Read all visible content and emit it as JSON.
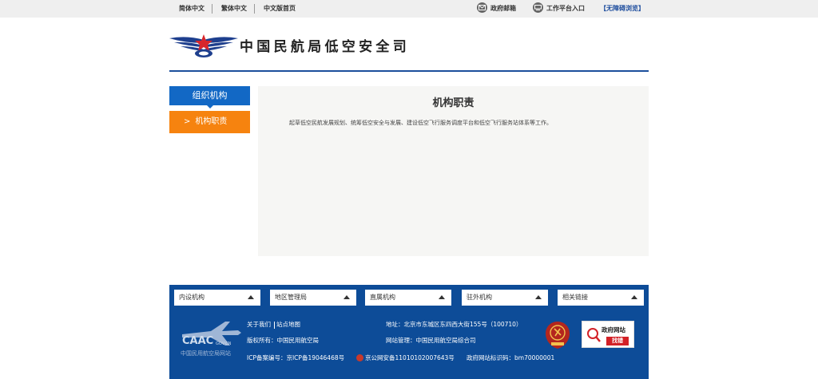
{
  "topbar": {
    "languages": [
      "简体中文",
      "繁体中文",
      "中文版首页"
    ],
    "links": [
      {
        "label": "政府邮箱",
        "icon": "mail-icon"
      },
      {
        "label": "工作平台入口",
        "icon": "platform-icon"
      }
    ],
    "accessibility": "【无障碍浏览】"
  },
  "header": {
    "title": "中国民航局低空安全司"
  },
  "sidebar": {
    "heading": "组织机构",
    "items": [
      {
        "arrow": ">",
        "label": "机构职责"
      }
    ]
  },
  "main": {
    "title": "机构职责",
    "text": "起草低空民航发展规划、统筹低空安全与发展、建设低空飞行服务调度平台和低空飞行服务站体系等工作。"
  },
  "footer": {
    "selects": [
      "内设机构",
      "地区管理局",
      "直属机构",
      "驻外机构",
      "相关链接"
    ],
    "brand": {
      "name": "CAAC",
      "domain": "GOV.CN",
      "subtitle": "中国民用航空局网站"
    },
    "about": "关于我们",
    "sitemap": "站点地图",
    "copyright": "版权所有：中国民用航空局",
    "icp": "ICP备案编号：京ICP备19046468号",
    "police": "京公网安备11010102007643号",
    "site_id": "政府网站标识码：bm70000001",
    "address": "地址：北京市东城区东四西大街155号（100710）",
    "manager": "网站管理：中国民用航空局综合司",
    "badge": {
      "line1": "政府网站",
      "line2": "找错"
    }
  },
  "colors": {
    "primary_blue": "#1268c5",
    "footer_blue": "#0d4c98",
    "accent_orange": "#f6830f",
    "header_line": "#1c4f9c"
  }
}
